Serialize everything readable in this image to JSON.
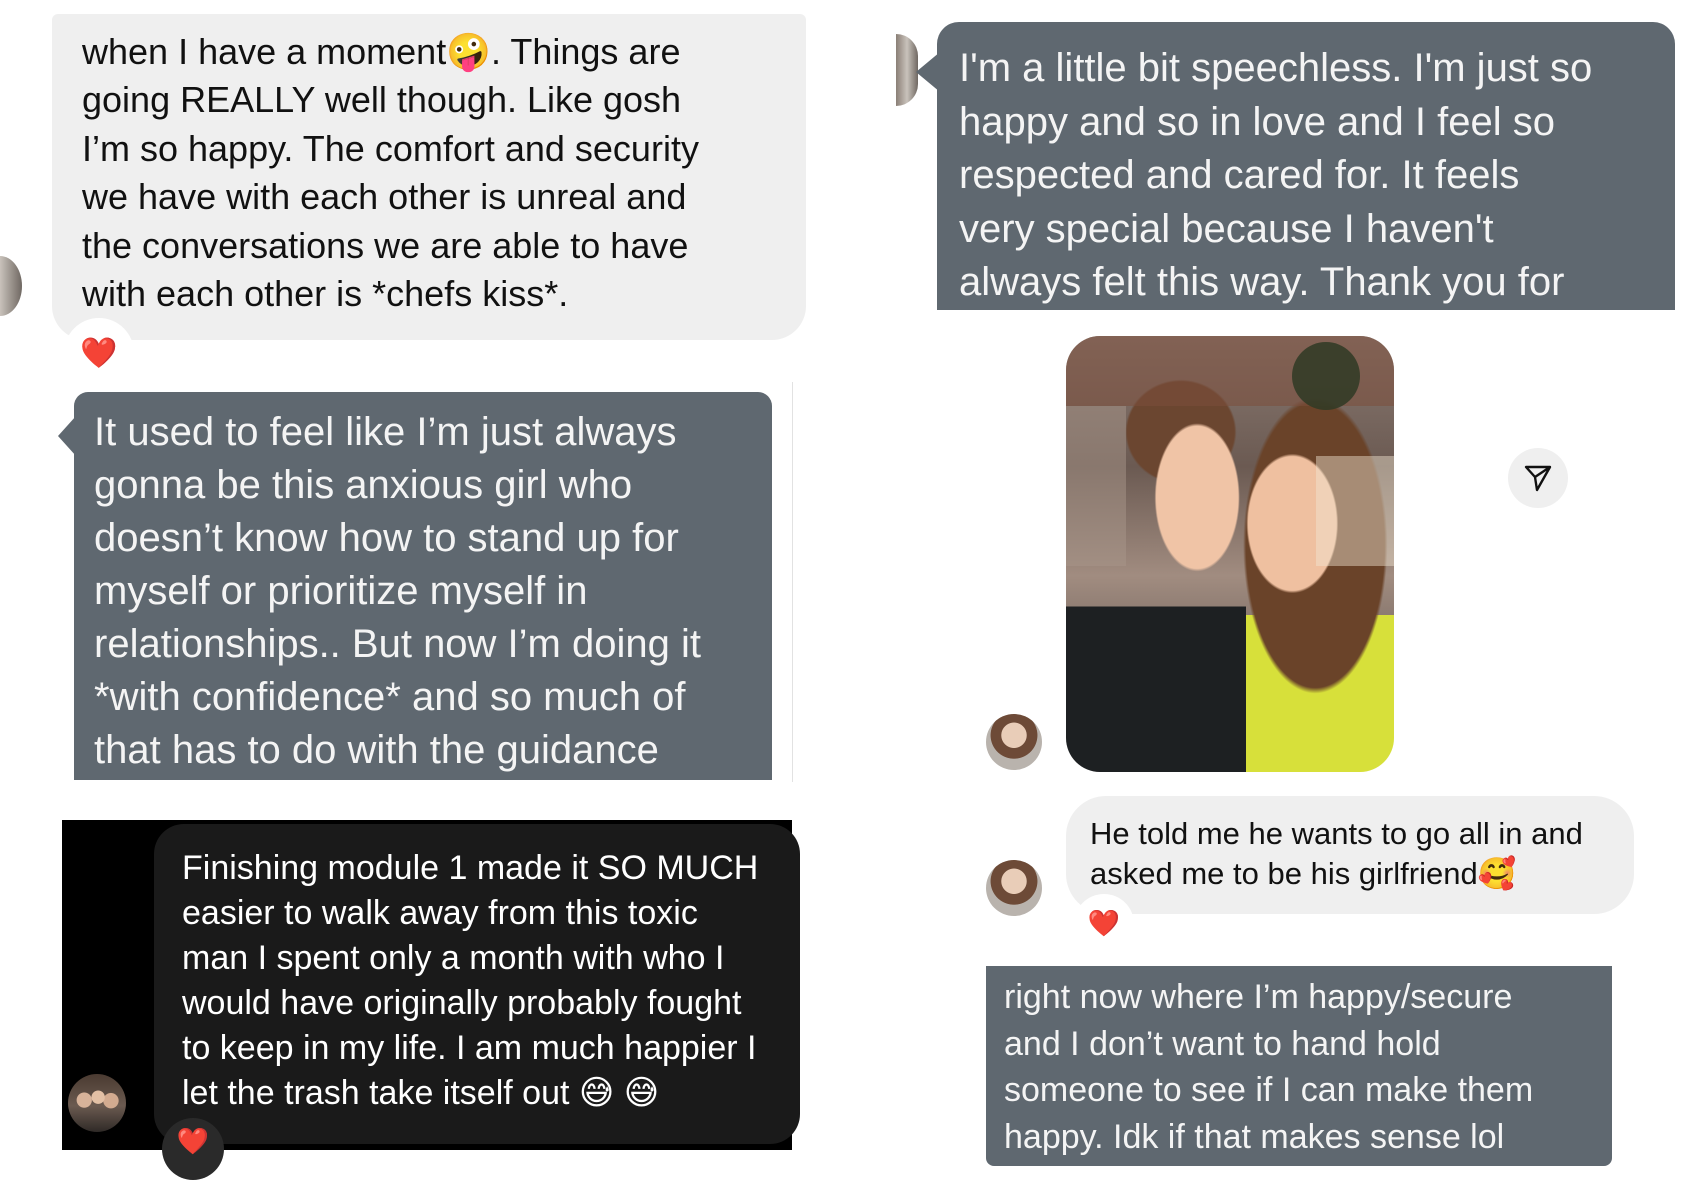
{
  "panel_top_left": {
    "message": "when I have a moment🤪. Things are\ngoing REALLY well though. Like gosh\nI’m so happy. The comfort and security\nwe have with each other is unreal and\nthe conversations we are able to have\nwith each other is *chefs kiss*.",
    "reaction": "❤️"
  },
  "panel_top_right": {
    "message": "I'm a little bit speechless. I'm just so\nhappy and so in love and I feel so\nrespected and cared for. It feels\nvery special because I haven't\nalways felt this way. Thank you for"
  },
  "panel_mid_left": {
    "message": "It used to feel like I’m just always\ngonna be this anxious girl who\ndoesn’t know how to stand up for\nmyself or prioritize myself in\nrelationships.. But now I’m doing it\n*with confidence* and so much of\nthat has to do with the guidance"
  },
  "panel_mid_right": {
    "photo_icon": "couple-selfie-photo",
    "send_icon": "send-icon"
  },
  "panel_bottom_left": {
    "message": "Finishing module 1 made it SO MUCH\neasier to walk away from this toxic\nman I spent only a month with who I\nwould have originally probably fought\nto keep in my life. I am much happier I\nlet the trash take itself out 😅 😅",
    "reaction": "❤️"
  },
  "panel_bottom_right_top": {
    "message": "He told me he wants to go all in and\nasked me to be his girlfriend🥰",
    "reaction": "❤️"
  },
  "panel_bottom_right_bottom": {
    "message": "right now where I’m happy/secure\nand I don’t want to hand hold\nsomeone to see if I can make them\nhappy. Idk if that makes sense lol"
  },
  "colors": {
    "light_bubble": "#efefef",
    "dark_bubble": "#5f6870",
    "heart": "#e0141c"
  }
}
